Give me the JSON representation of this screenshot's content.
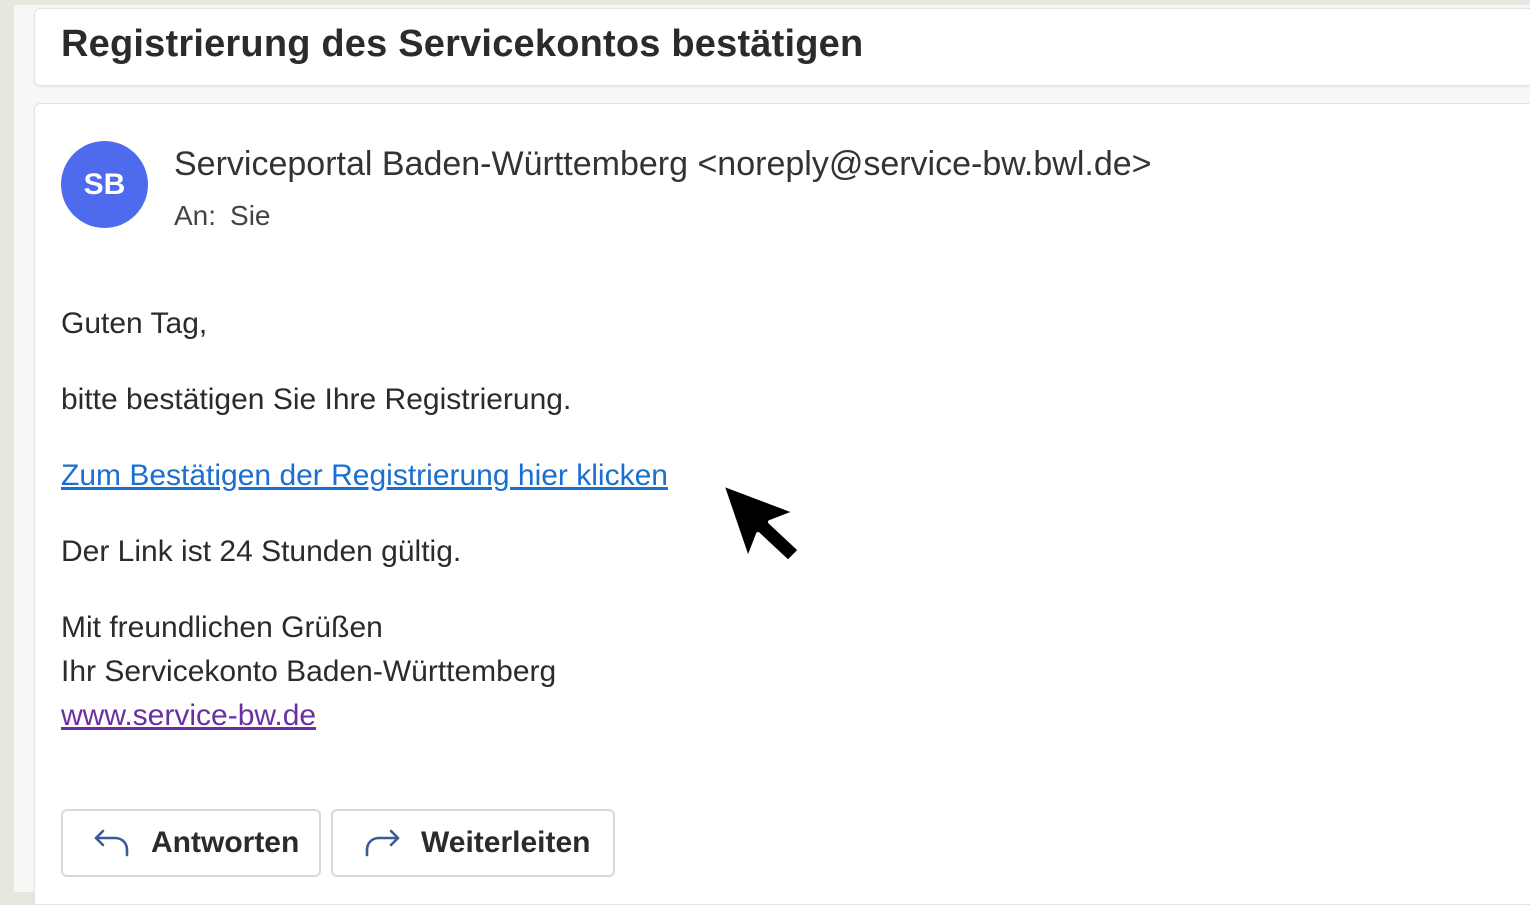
{
  "email": {
    "subject": "Registrierung des Servicekontos bestätigen",
    "avatar_initials": "SB",
    "sender": "Serviceportal Baden-Württemberg <noreply@service-bw.bwl.de>",
    "to_label": "An:",
    "to_value": "Sie",
    "greeting": "Guten Tag,",
    "line1": "bitte bestätigen Sie Ihre Registrierung.",
    "confirm_link": "Zum Bestätigen der Registrierung hier klicken",
    "validity": "Der Link ist 24 Stunden gültig.",
    "closing": "Mit freundlichen Grüßen",
    "signature": "Ihr Servicekonto Baden-Württemberg",
    "website_link": "www.service-bw.de"
  },
  "actions": {
    "reply_label": "Antworten",
    "forward_label": "Weiterleiten"
  },
  "colors": {
    "avatar": "#4f6bed",
    "link": "#1a6fd1",
    "visited_link": "#6b2fa4"
  },
  "icons": [
    "reply-icon",
    "forward-icon",
    "mouse-cursor-icon"
  ]
}
